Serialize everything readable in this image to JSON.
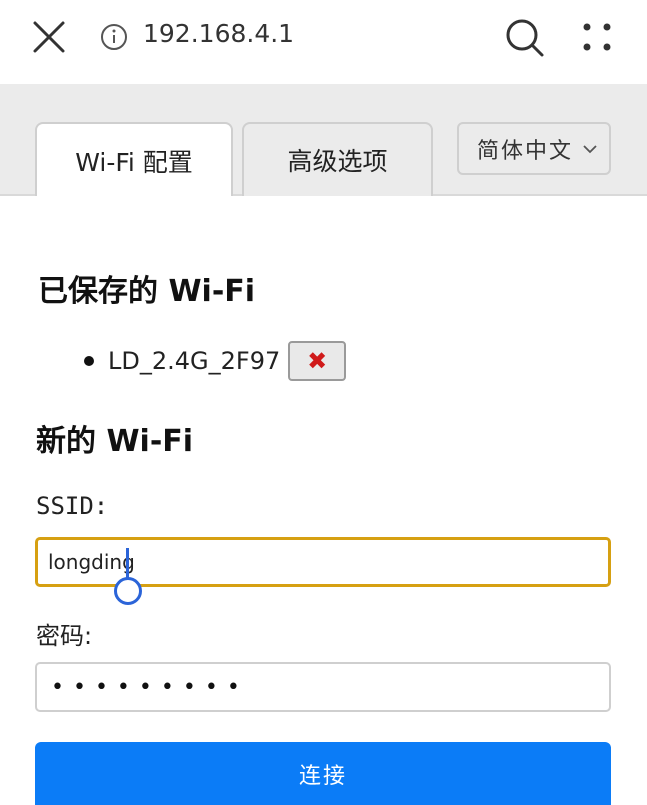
{
  "browser": {
    "url": "192.168.4.1",
    "close_icon": "close-icon",
    "info_icon": "info-icon",
    "search_icon": "search-icon",
    "more_icon": "more-dots-icon"
  },
  "tabs": [
    {
      "label": "Wi-Fi 配置",
      "active": true
    },
    {
      "label": "高级选项",
      "active": false
    }
  ],
  "language": {
    "selected": "简体中文"
  },
  "saved": {
    "heading": "已保存的 Wi-Fi",
    "items": [
      {
        "ssid": "LD_2.4G_2F97",
        "delete_label": "✖"
      }
    ]
  },
  "new_wifi": {
    "heading": "新的 Wi-Fi",
    "ssid_label": "SSID:",
    "ssid_value": "longding",
    "password_label": "密码:",
    "password_value": "•••••••••",
    "connect_label": "连接"
  },
  "colors": {
    "accent": "#0b7cf7",
    "focus_border": "#d6a012",
    "delete_red": "#d01a1a",
    "caret": "#2b64d8"
  }
}
